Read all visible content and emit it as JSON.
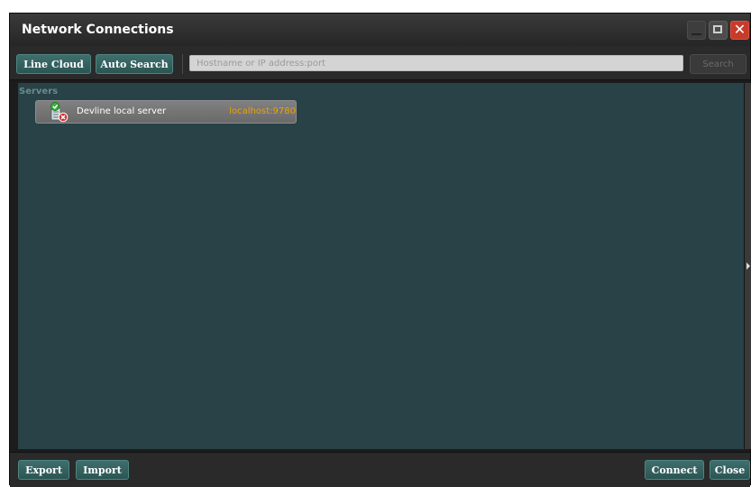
{
  "window": {
    "title": "Network Connections"
  },
  "toolbar": {
    "line_cloud_label": "Line Cloud",
    "auto_search_label": "Auto Search",
    "address_placeholder": "Hostname or IP address:port",
    "address_value": "",
    "search_label": "Search"
  },
  "servers": {
    "group_label": "Servers",
    "items": [
      {
        "name": "Devline local server",
        "address": "localhost:9780",
        "icon": "server-status-icon"
      }
    ]
  },
  "footer": {
    "export_label": "Export",
    "import_label": "Import",
    "connect_label": "Connect",
    "close_label": "Close"
  },
  "colors": {
    "accent_button": "#2f5b59",
    "list_background": "#284247",
    "address_text": "#f0a000",
    "close_button": "#c63b2a"
  }
}
